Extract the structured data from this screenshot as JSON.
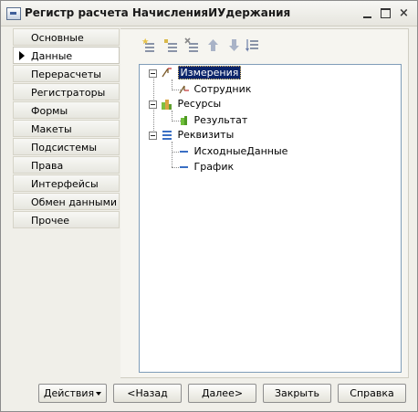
{
  "window": {
    "title": "Регистр расчета НачисленияИУдержания"
  },
  "titlebar_controls": {
    "close_label": "×"
  },
  "sidebar": {
    "items": [
      {
        "label": "Основные"
      },
      {
        "label": "Данные"
      },
      {
        "label": "Перерасчеты"
      },
      {
        "label": "Регистраторы"
      },
      {
        "label": "Формы"
      },
      {
        "label": "Макеты"
      },
      {
        "label": "Подсистемы"
      },
      {
        "label": "Права"
      },
      {
        "label": "Интерфейсы"
      },
      {
        "label": "Обмен данными"
      },
      {
        "label": "Прочее"
      }
    ]
  },
  "toolbar": {
    "icons": [
      "add-icon",
      "add-child-icon",
      "delete-icon",
      "move-up-icon",
      "move-down-icon",
      "sort-icon"
    ]
  },
  "tree": {
    "groups": [
      {
        "label": "Измерения",
        "icon": "dimensions-icon",
        "children": [
          {
            "label": "Сотрудник"
          }
        ]
      },
      {
        "label": "Ресурсы",
        "icon": "resources-icon",
        "children": [
          {
            "label": "Результат"
          }
        ]
      },
      {
        "label": "Реквизиты",
        "icon": "attributes-icon",
        "children": [
          {
            "label": "ИсходныеДанные"
          },
          {
            "label": "График"
          }
        ]
      }
    ]
  },
  "footer": {
    "actions_label": "Действия",
    "back_label": "<Назад",
    "next_label": "Далее>",
    "close_label": "Закрыть",
    "help_label": "Справка"
  },
  "colors": {
    "selection": "#0a246a",
    "tree_border": "#7f9db9",
    "dialog_bg": "#f0efe9"
  }
}
